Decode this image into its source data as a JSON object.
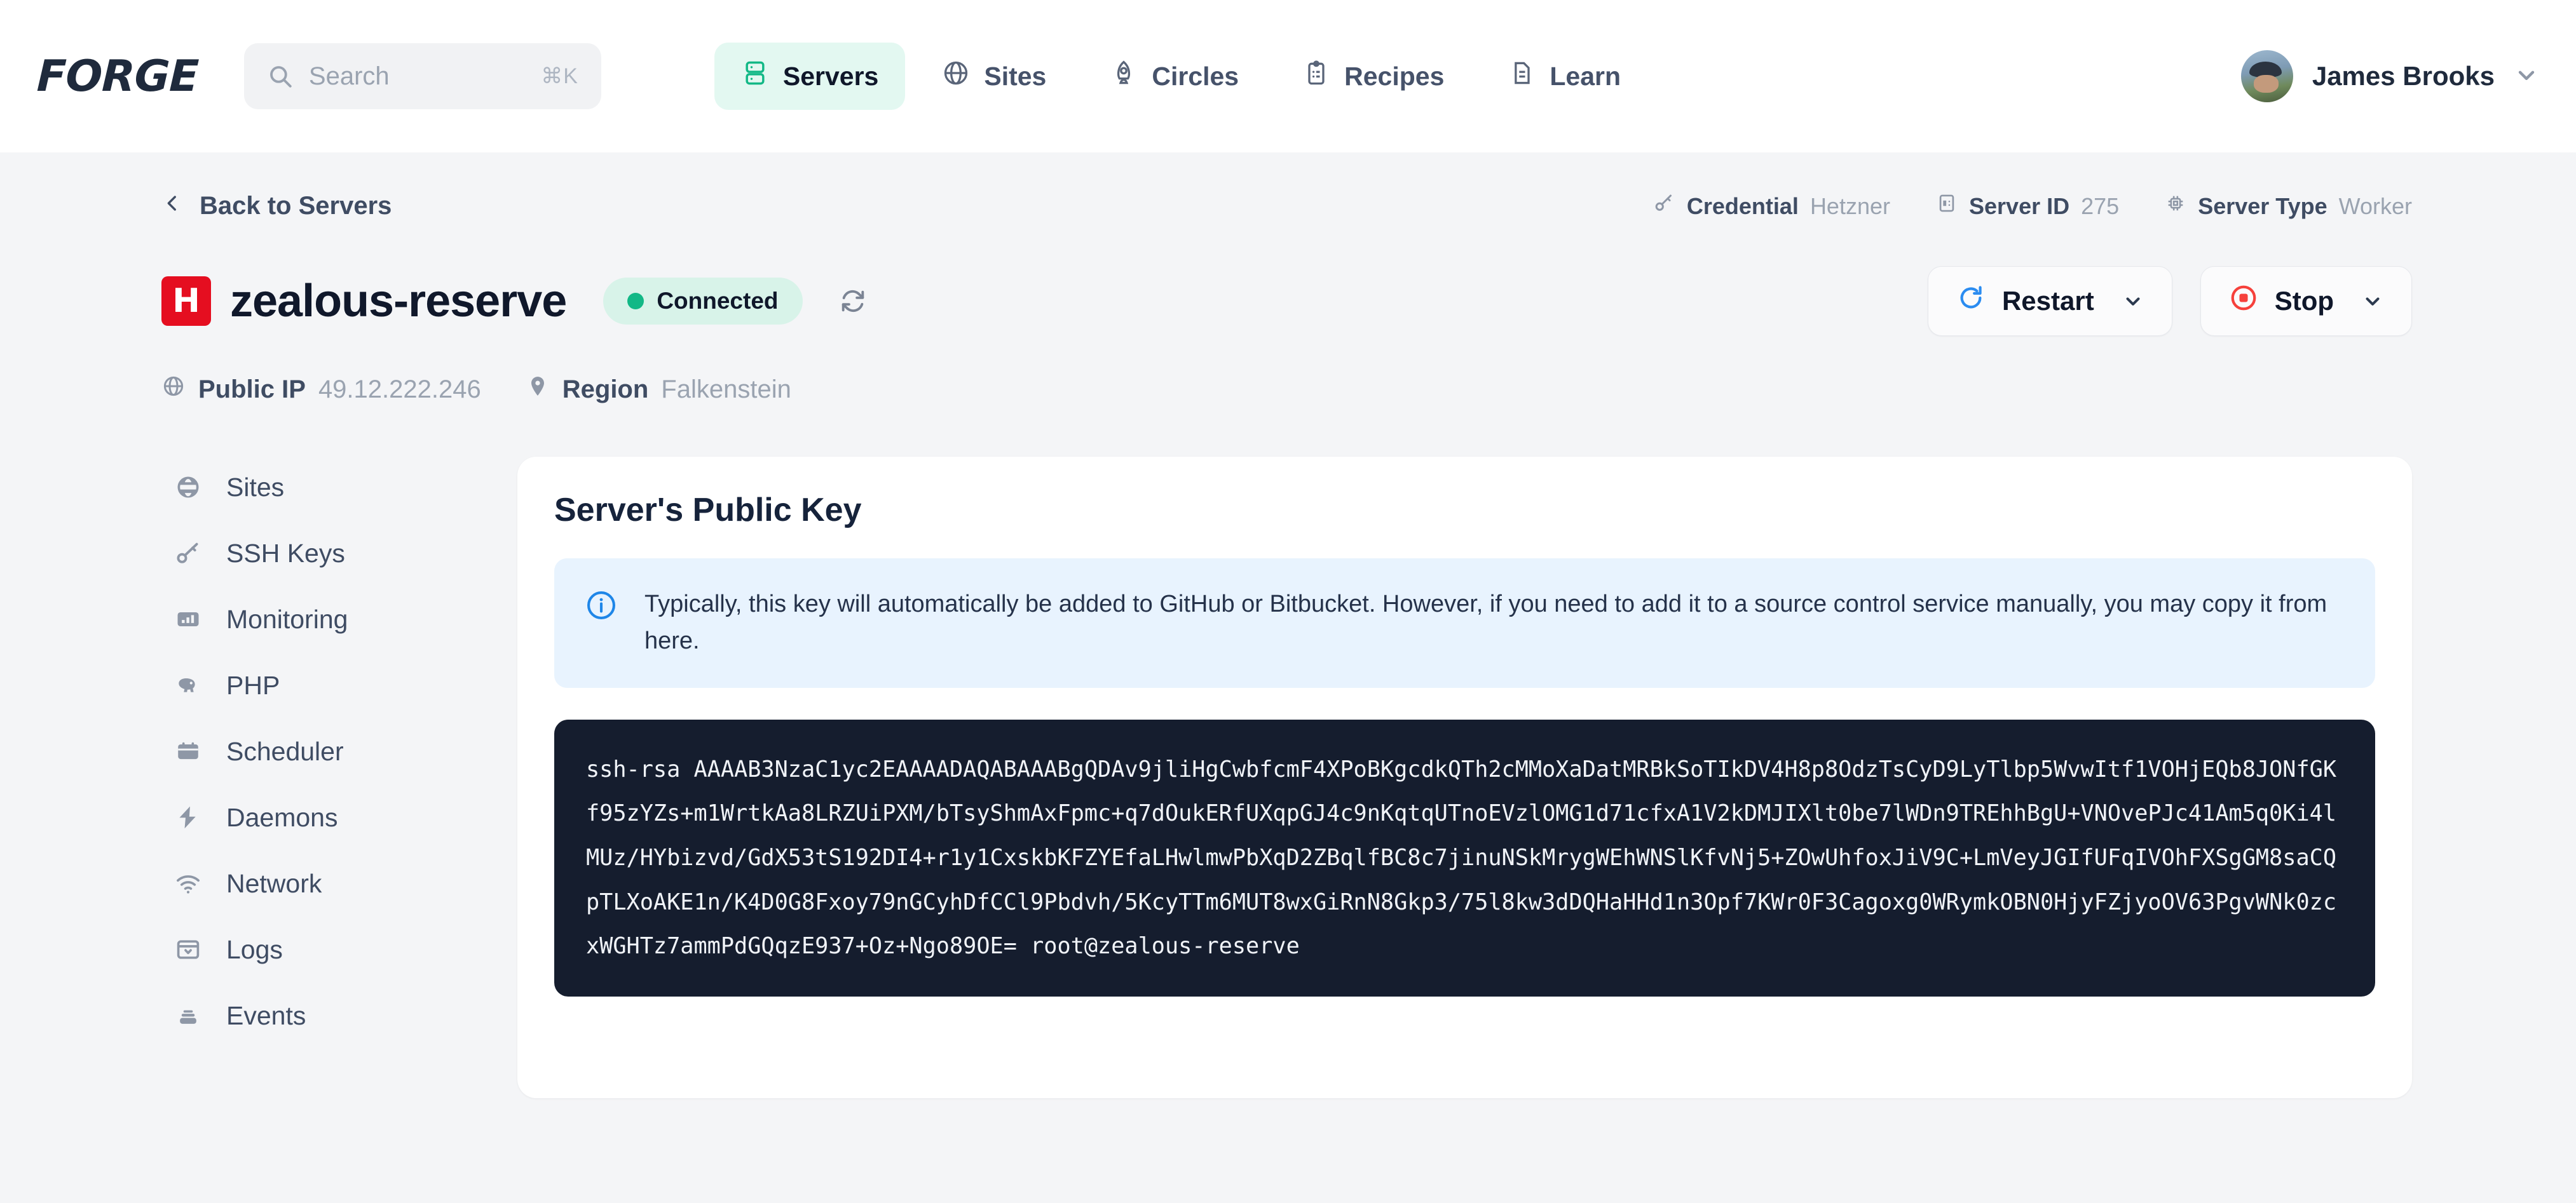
{
  "brand": {
    "logo": "FORGE"
  },
  "search": {
    "placeholder": "Search",
    "shortcut": "⌘K"
  },
  "nav": [
    {
      "label": "Servers",
      "icon": "server-icon",
      "active": true
    },
    {
      "label": "Sites",
      "icon": "globe-icon",
      "active": false
    },
    {
      "label": "Circles",
      "icon": "rocket-icon",
      "active": false
    },
    {
      "label": "Recipes",
      "icon": "clipboard-icon",
      "active": false
    },
    {
      "label": "Learn",
      "icon": "document-icon",
      "active": false
    }
  ],
  "user": {
    "name": "James Brooks",
    "avatar": "user-avatar",
    "caret": "chevron-down-icon"
  },
  "breadcrumb": {
    "label": "Back to Servers",
    "icon": "chevron-left-icon"
  },
  "meta": [
    {
      "label": "Credential",
      "value": "Hetzner",
      "icon": "key-icon"
    },
    {
      "label": "Server ID",
      "value": "275",
      "icon": "server-id-icon"
    },
    {
      "label": "Server Type",
      "value": "Worker",
      "icon": "chip-icon"
    }
  ],
  "server": {
    "provider_initial": "H",
    "provider_color": "#e50e20",
    "name": "zealous-reserve",
    "status": "Connected",
    "status_color": "#12b886",
    "refresh_icon": "refresh-icon"
  },
  "actions": [
    {
      "label": "Restart",
      "icon": "restart-icon",
      "icon_color": "#2b8cf0",
      "caret": "chevron-down-icon"
    },
    {
      "label": "Stop",
      "icon": "stop-icon",
      "icon_color": "#f6413c",
      "caret": "chevron-down-icon"
    }
  ],
  "details": [
    {
      "label": "Public IP",
      "value": "49.12.222.246",
      "icon": "globe-icon"
    },
    {
      "label": "Region",
      "value": "Falkenstein",
      "icon": "map-pin-icon"
    }
  ],
  "sidebar": {
    "items": [
      {
        "label": "Sites",
        "icon": "globe-icon"
      },
      {
        "label": "SSH Keys",
        "icon": "key-icon"
      },
      {
        "label": "Monitoring",
        "icon": "chart-icon"
      },
      {
        "label": "PHP",
        "icon": "php-elephant-icon"
      },
      {
        "label": "Scheduler",
        "icon": "calendar-icon"
      },
      {
        "label": "Daemons",
        "icon": "bolt-icon"
      },
      {
        "label": "Network",
        "icon": "wifi-icon"
      },
      {
        "label": "Logs",
        "icon": "archive-icon"
      },
      {
        "label": "Events",
        "icon": "stack-icon"
      }
    ]
  },
  "card": {
    "title": "Server's Public Key",
    "notice": {
      "icon": "info-icon",
      "text": "Typically, this key will automatically be added to GitHub or Bitbucket. However, if you need to add it to a source control service manually, you may copy it from here."
    },
    "public_key": "ssh-rsa AAAAB3NzaC1yc2EAAAADAQABAAABgQDAv9jliHgCwbfcmF4XPoBKgcdkQTh2cMMoXaDatMRBkSoTIkDV4H8p8OdzTsCyD9LyTlbp5WvwItf1VOHjEQb8JONfGKf95zYZs+m1WrtkAa8LRZUiPXM/bTsyShmAxFpmc+q7dOukERfUXqpGJ4c9nKqtqUTnoEVzlOMG1d71cfxA1V2kDMJIXlt0be7lWDn9TREhhBgU+VNOvePJc41Am5q0Ki4lMUz/HYbizvd/GdX53tS192DI4+r1y1CxskbKFZYEfaLHwlmwPbXqD2ZBqlfBC8c7jinuNSkMrygWEhWNSlKfvNj5+ZOwUhfoxJiV9C+LmVeyJGIfUFqIVOhFXSgGM8saCQpTLXoAKE1n/K4D0G8Fxoy79nGCyhDfCCl9Pbdvh/5KcyTTm6MUT8wxGiRnN8Gkp3/75l8kw3dDQHaHHd1n3Opf7KWr0F3Cagoxg0WRymkOBN0HjyFZjyoOV63PgvWNk0zcxWGHTz7ammPdGQqzE937+Oz+Ngo89OE= root@zealous-reserve"
  }
}
